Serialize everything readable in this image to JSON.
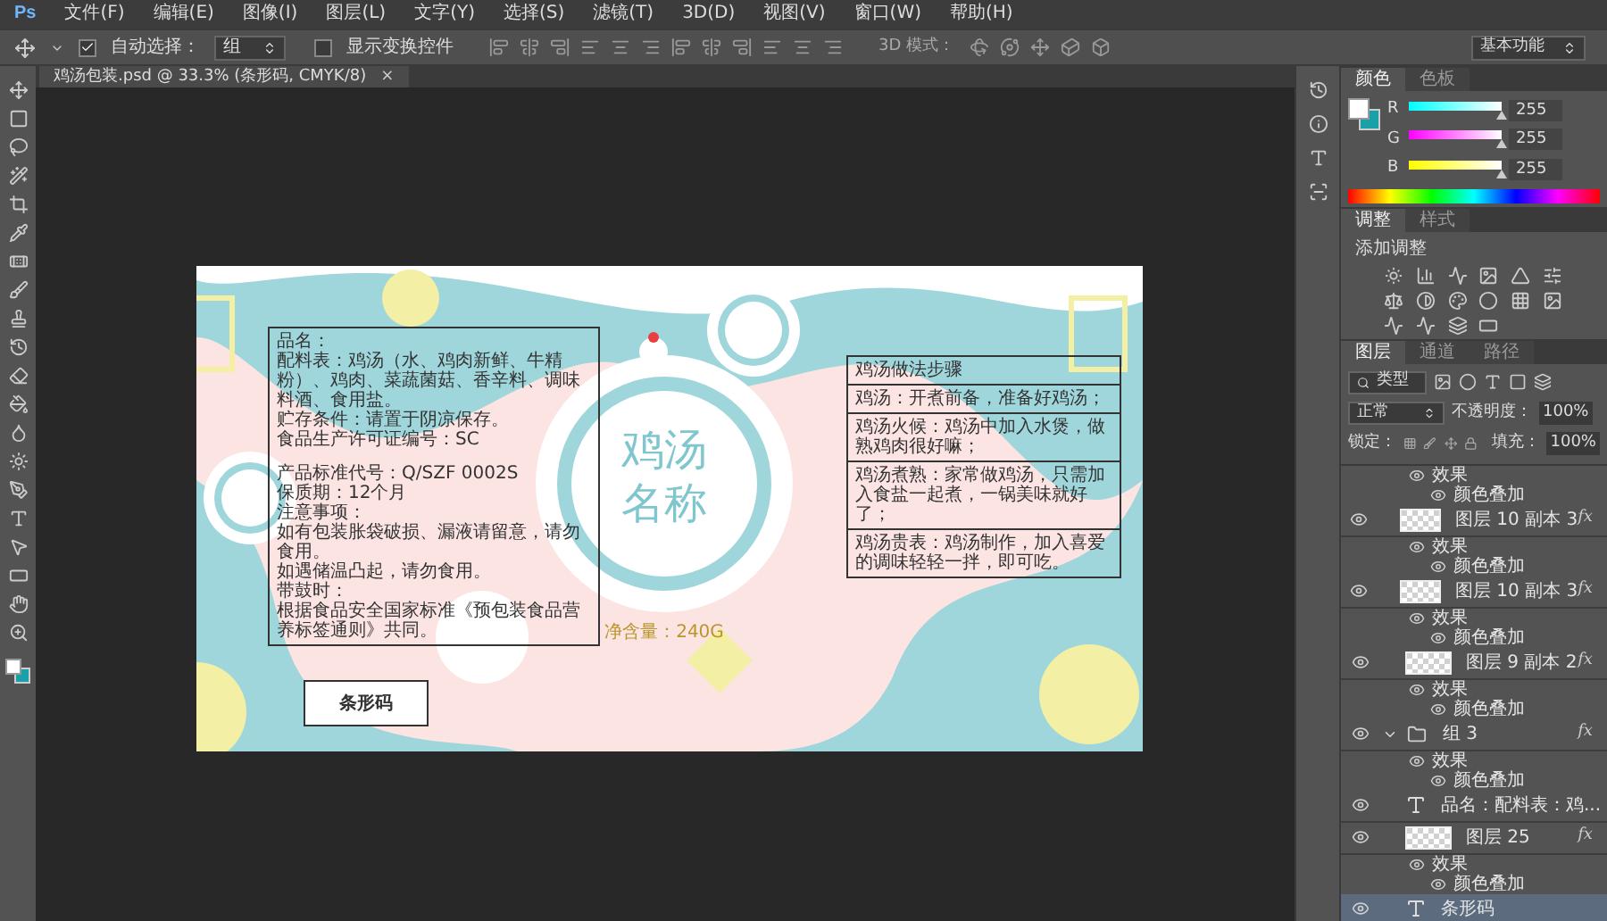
{
  "app_logo": "Ps",
  "menu": [
    "文件(F)",
    "编辑(E)",
    "图像(I)",
    "图层(L)",
    "文字(Y)",
    "选择(S)",
    "滤镜(T)",
    "3D(D)",
    "视图(V)",
    "窗口(W)",
    "帮助(H)"
  ],
  "options_bar": {
    "auto_select": {
      "label": "自动选择：",
      "checked": true
    },
    "auto_select_target": "组",
    "transform_controls": {
      "label": "显示变换控件",
      "checked": false
    },
    "mode_3d_label": "3D 模式：",
    "workspace": "基本功能"
  },
  "document_tab": {
    "title": "鸡汤包装.psd @ 33.3% (条形码, CMYK/8)",
    "close": "×"
  },
  "document": {
    "title_lines": [
      "鸡汤",
      "名称"
    ],
    "net_content": "净含量：240G",
    "barcode_label": "条形码",
    "info_lines": [
      "品名：",
      "配料表：鸡汤（水、鸡肉新鲜、牛精粉）、鸡肉、菜蔬菌菇、香辛料、调味料酒、食用盐。",
      "贮存条件：请置于阴凉保存。",
      "食品生产许可证编号：SC",
      "产品标准代号：Q/SZF 0002S",
      "保质期：12个月",
      "注意事项：",
      "如有包装胀袋破损、漏液请留意，请勿食用。",
      "如遇储温凸起，请勿食用。",
      "带鼓时：",
      "根据食品安全国家标准《预包装食品营养标签通则》共同。"
    ],
    "recipe_rows": [
      "鸡汤做法步骤",
      "鸡汤：开煮前备，准备好鸡汤；",
      "鸡汤火候：鸡汤中加入水煲，做熟鸡肉很好嘛；",
      "鸡汤煮熟：家常做鸡汤，只需加入食盐一起煮，一锅美味就好了；",
      "鸡汤贵表：鸡汤制作，加入喜爱的调味轻轻一拌，即可吃。"
    ]
  },
  "color_panel": {
    "tabs": [
      {
        "label": "颜色",
        "selected": true
      },
      {
        "label": "色板",
        "selected": false
      }
    ],
    "channels": [
      {
        "name": "R",
        "value": "255",
        "level": 1
      },
      {
        "name": "G",
        "value": "255",
        "level": 1
      },
      {
        "name": "B",
        "value": "255",
        "level": 1
      }
    ]
  },
  "adjustments_panel": {
    "tabs": [
      {
        "label": "调整",
        "selected": true
      },
      {
        "label": "样式",
        "selected": false
      }
    ],
    "heading": "添加调整"
  },
  "layers_panel": {
    "tabs": [
      {
        "label": "图层",
        "selected": true
      },
      {
        "label": "通道",
        "selected": false
      },
      {
        "label": "路径",
        "selected": false
      }
    ],
    "filter": "类型",
    "blend_mode": "正常",
    "opacity_label": "不透明度：",
    "opacity": "100%",
    "lock_label": "锁定：",
    "fill_label": "填充：",
    "fill": "100%",
    "layers": [
      {
        "kind": "effects",
        "name": "效果",
        "selected": false
      },
      {
        "kind": "effect",
        "name": "颜色叠加",
        "selected": false
      },
      {
        "kind": "layer",
        "name": "图层 10 副本 3",
        "fx": "fx",
        "selected": false
      },
      {
        "kind": "effects",
        "name": "效果",
        "selected": false
      },
      {
        "kind": "effect",
        "name": "颜色叠加",
        "selected": false
      },
      {
        "kind": "layer",
        "name": "图层 10 副本 3",
        "fx": "fx",
        "selected": false
      },
      {
        "kind": "effects",
        "name": "效果",
        "selected": false
      },
      {
        "kind": "effect",
        "name": "颜色叠加",
        "selected": false
      },
      {
        "kind": "layer",
        "name": "图层 9 副本 2",
        "fx": "fx",
        "selected": false
      },
      {
        "kind": "effects",
        "name": "效果",
        "selected": false
      },
      {
        "kind": "effect",
        "name": "颜色叠加",
        "selected": false
      },
      {
        "kind": "group",
        "name": "组 3",
        "fx": "fx",
        "expanded": true,
        "selected": false
      },
      {
        "kind": "effects",
        "name": "效果",
        "selected": false
      },
      {
        "kind": "effect",
        "name": "颜色叠加",
        "selected": false
      },
      {
        "kind": "text",
        "name": "品名：配料表：鸡...",
        "selected": false
      },
      {
        "kind": "layer",
        "name": "图层 25",
        "fx": "fx",
        "selected": false
      },
      {
        "kind": "effects",
        "name": "效果",
        "selected": false
      },
      {
        "kind": "effect",
        "name": "颜色叠加",
        "selected": false
      },
      {
        "kind": "text",
        "name": "条形码",
        "selected": true
      }
    ]
  }
}
